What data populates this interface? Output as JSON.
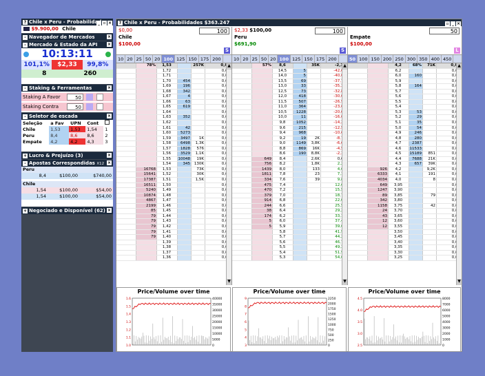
{
  "left": {
    "win_title": "Chile x Peru - Probabilidad",
    "balance": "$9.900,00",
    "balance_sel": "Chile",
    "navigator": "Navegador de Mercados",
    "api_title": "Mercado & Estado da API",
    "clock": "10:13:11",
    "back_pct": "101,1%",
    "mid_val": "$2,33",
    "lay_pct": "99,8%",
    "left_count": "8",
    "right_count": "260",
    "staking_title": "Staking & Ferramentas",
    "stake_fav_label": "Staking A Favor",
    "stake_fav": "50",
    "stake_con_label": "Staking Contra",
    "stake_con": "50",
    "selector_title": "Seletor de escada",
    "sel_headers": [
      "Seleção",
      "a Fav",
      "UPN",
      "Cont"
    ],
    "sel_rows": [
      [
        "Chile",
        "1,53",
        "1,53",
        "1,54",
        "1"
      ],
      [
        "Peru",
        "8,4",
        "8,6",
        "8,6",
        "2"
      ],
      [
        "Empate",
        "4,2",
        "4,2",
        "4,3",
        "3"
      ]
    ],
    "profit_title": "Lucro & Prejuízo (3)",
    "bets_title": "Apostas Correspondidas",
    "bets_tag": "X12",
    "bets_peru": "Peru",
    "bets_peru_row": [
      "8,4",
      "$100,00",
      "$740,00"
    ],
    "bets_chile": "Chile",
    "bets_chile_rows": [
      [
        "1,54",
        "$100,00",
        "$54,00"
      ],
      [
        "1,54",
        "$100,00",
        "$54,00"
      ]
    ],
    "neg_title": "Negociado e Disponível (62)"
  },
  "main": {
    "title": "Chile x Peru - Probabilidades",
    "amount": "$363.247"
  },
  "markets": [
    {
      "name": "Chile",
      "l1a": "$0,00",
      "l1b": "",
      "l3": "$100,00",
      "qty": "100",
      "letter": "S",
      "stakes": [
        "10",
        "20",
        "25",
        "50",
        "20",
        "100",
        "125",
        "150",
        "175",
        "200"
      ],
      "sel": "100",
      "hdr": [
        "",
        "78%",
        "1,53",
        "",
        "257K",
        "0,00"
      ],
      "rows": [
        [
          "",
          "",
          "1,72",
          "",
          "",
          "0,00"
        ],
        [
          "",
          "",
          "1,71",
          "",
          "",
          "0,00"
        ],
        [
          "",
          "",
          "1,70",
          "454",
          "",
          "0,00"
        ],
        [
          "",
          "",
          "1,69",
          "196",
          "",
          "0,00"
        ],
        [
          "",
          "",
          "1,68",
          "342",
          "",
          "0,00"
        ],
        [
          "",
          "",
          "1,67",
          "4",
          "",
          "0,00"
        ],
        [
          "",
          "",
          "1,66",
          "63",
          "",
          "0,00"
        ],
        [
          "",
          "",
          "1,65",
          "619",
          "",
          "0,00"
        ],
        [
          "",
          "",
          "1,64",
          "",
          "",
          "0,00"
        ],
        [
          "",
          "",
          "1,63",
          "352",
          "",
          "0,00"
        ],
        [
          "",
          "",
          "1,62",
          "",
          "",
          "0,00"
        ],
        [
          "",
          "",
          "1,61",
          "42",
          "",
          "0,00"
        ],
        [
          "",
          "",
          "1,60",
          "5273",
          "",
          "0,00"
        ],
        [
          "",
          "",
          "1,59",
          "3497",
          "1K",
          "0,00"
        ],
        [
          "",
          "",
          "1,58",
          "6498",
          "1,3K",
          "0,00"
        ],
        [
          "",
          "",
          "1,57",
          "1828",
          "576",
          "0,00"
        ],
        [
          "",
          "",
          "1,56",
          "3529",
          "1,1K",
          "0,00"
        ],
        [
          "",
          "",
          "1,55",
          "10048",
          "19K",
          "0,00"
        ],
        [
          "",
          "",
          "1,54",
          "345",
          "130K",
          "0,00"
        ],
        [
          "",
          "16768",
          "1,53",
          "",
          "73K",
          "0,00"
        ],
        [
          "",
          "15641",
          "1,52",
          "",
          "30K",
          "0,00"
        ],
        [
          "",
          "17387",
          "1,51",
          "",
          "1,5K",
          "0,00"
        ],
        [
          "",
          "16511",
          "1,50",
          "",
          "",
          "0,00"
        ],
        [
          "",
          "5240",
          "1,49",
          "",
          "",
          "0,00"
        ],
        [
          "",
          "10874",
          "1,48",
          "",
          "",
          "0,00"
        ],
        [
          "",
          "4867",
          "1,47",
          "",
          "",
          "0,00"
        ],
        [
          "",
          "2199",
          "1,46",
          "",
          "",
          "0,00"
        ],
        [
          "",
          "85",
          "1,45",
          "",
          "",
          "0,00"
        ],
        [
          "",
          "79",
          "1,44",
          "",
          "",
          "0,00"
        ],
        [
          "",
          "79",
          "1,43",
          "",
          "",
          "0,00"
        ],
        [
          "",
          "79",
          "1,42",
          "",
          "",
          "0,00"
        ],
        [
          "",
          "79",
          "1,41",
          "",
          "",
          "0,00"
        ],
        [
          "",
          "79",
          "1,40",
          "",
          "",
          "0,00"
        ],
        [
          "",
          "",
          "1,39",
          "",
          "",
          "0,00"
        ],
        [
          "",
          "",
          "1,38",
          "",
          "",
          "0,00"
        ],
        [
          "",
          "",
          "1,37",
          "",
          "",
          "0,00"
        ],
        [
          "",
          "",
          "1,36",
          "",
          "",
          "0,00"
        ]
      ],
      "chart": {
        "title": "Price/Volume over time",
        "yl": [
          "1.6",
          "1.5",
          "1.4",
          "1.3",
          "1.2",
          "1.1",
          "1.0"
        ],
        "yr": [
          "40000",
          "35000",
          "30000",
          "25000",
          "20000",
          "15000",
          "10000",
          "5000",
          "0"
        ]
      }
    },
    {
      "name": "Peru",
      "l1a": "$2,33",
      "l1b": "$100,00",
      "l3": "$691,90",
      "qty": "100",
      "letter": "S",
      "stakes": [
        "10",
        "20",
        "25",
        "50",
        "20",
        "100",
        "125",
        "150",
        "175",
        "200"
      ],
      "sel": "100",
      "hdr": [
        "",
        "57%",
        "8,6",
        "",
        "35K",
        "-2,33"
      ],
      "rows": [
        [
          "",
          "",
          "14,5",
          "5",
          "",
          "-42,07"
        ],
        [
          "",
          "",
          "14,0",
          "5",
          "",
          "-40,00"
        ],
        [
          "",
          "",
          "13,5",
          "69",
          "",
          "-37,78"
        ],
        [
          "",
          "",
          "13,0",
          "33",
          "",
          "-35,38"
        ],
        [
          "",
          "",
          "12,5",
          "73",
          "",
          "-32,80"
        ],
        [
          "",
          "",
          "12,0",
          "418",
          "",
          "-30,00"
        ],
        [
          "",
          "",
          "11,5",
          "507",
          "",
          "-26,96"
        ],
        [
          "",
          "",
          "11,0",
          "364",
          "",
          "-23,64"
        ],
        [
          "",
          "",
          "10,5",
          "1228",
          "",
          "-20,00"
        ],
        [
          "",
          "",
          "10,0",
          "11",
          "",
          "-16,00"
        ],
        [
          "",
          "",
          "9,8",
          "1052",
          "",
          "-14,29"
        ],
        [
          "",
          "",
          "9,6",
          "215",
          "",
          "-12,50"
        ],
        [
          "",
          "",
          "9,4",
          "968",
          "",
          "-10,64"
        ],
        [
          "",
          "",
          "9,2",
          "19",
          "2K",
          "-8,70"
        ],
        [
          "",
          "",
          "9,0",
          "1149",
          "3,8K",
          "-6,67"
        ],
        [
          "",
          "",
          "8,8",
          "869",
          "16K",
          "-4,55"
        ],
        [
          "",
          "",
          "8,6",
          "190",
          "8,8K",
          "-2,33"
        ],
        [
          "",
          "649",
          "8,4",
          "",
          "2,6K",
          "0,00"
        ],
        [
          "",
          "756",
          "8,2",
          "",
          "1,8K",
          "2,28"
        ],
        [
          "",
          "1439",
          "8,0",
          "",
          "133",
          "4,68"
        ],
        [
          "",
          "1811",
          "7,8",
          "",
          "23",
          "7,19"
        ],
        [
          "",
          "334",
          "7,6",
          "",
          "39",
          "9,85"
        ],
        [
          "",
          "475",
          "7,4",
          "",
          "",
          "12,63"
        ],
        [
          "",
          "470",
          "7,2",
          "",
          "",
          "15,59"
        ],
        [
          "",
          "379",
          "7,0",
          "",
          "",
          "18,70"
        ],
        [
          "",
          "914",
          "6,8",
          "",
          "",
          "22,00"
        ],
        [
          "",
          "244",
          "6,6",
          "",
          "",
          "25,50"
        ],
        [
          "",
          "38",
          "6,4",
          "",
          "",
          "29,22"
        ],
        [
          "",
          "174",
          "6,2",
          "",
          "",
          "33,17"
        ],
        [
          "",
          "5",
          "6,0",
          "",
          "",
          "37,40"
        ],
        [
          "",
          "5",
          "5,9",
          "",
          "",
          "39,62"
        ],
        [
          "",
          "",
          "5,8",
          "",
          "",
          "41,92"
        ],
        [
          "",
          "",
          "5,7",
          "",
          "",
          "44,29"
        ],
        [
          "",
          "",
          "5,6",
          "",
          "",
          "46,75"
        ],
        [
          "",
          "",
          "5,5",
          "",
          "",
          "49,30"
        ],
        [
          "",
          "",
          "5,4",
          "",
          "",
          "51,95"
        ],
        [
          "",
          "",
          "5,3",
          "",
          "",
          "54,69"
        ]
      ],
      "chart": {
        "title": "Price/Volume over time",
        "yl": [
          "9",
          "8",
          "7",
          "6",
          "5",
          "4",
          "3"
        ],
        "yr": [
          "2250",
          "2000",
          "1750",
          "1500",
          "1250",
          "1000",
          "750",
          "500",
          "250",
          "0"
        ]
      }
    },
    {
      "name": "Empate",
      "l1a": "",
      "l1b": "",
      "l3": "$100,00",
      "qty": "50",
      "letter": "L",
      "stakes": [
        "50",
        "100",
        "150",
        "200",
        "250",
        "300",
        "350",
        "400",
        "450"
      ],
      "sel": "50",
      "hdr": [
        "",
        "",
        "4,2",
        "68%",
        "71K",
        "0,00"
      ],
      "rows": [
        [
          "",
          "",
          "6,2",
          "",
          "",
          "0,00"
        ],
        [
          "",
          "",
          "6,0",
          "160",
          "",
          "0,00"
        ],
        [
          "",
          "",
          "5,9",
          "",
          "",
          "0,00"
        ],
        [
          "",
          "",
          "5,8",
          "164",
          "",
          "0,00"
        ],
        [
          "",
          "",
          "5,7",
          "",
          "",
          "0,00"
        ],
        [
          "",
          "",
          "5,6",
          "",
          "",
          "0,00"
        ],
        [
          "",
          "",
          "5,5",
          "",
          "",
          "0,00"
        ],
        [
          "",
          "",
          "5,4",
          "",
          "",
          "0,00"
        ],
        [
          "",
          "",
          "5,3",
          "53",
          "",
          "0,00"
        ],
        [
          "",
          "",
          "5,2",
          "29",
          "",
          "0,00"
        ],
        [
          "",
          "",
          "5,1",
          "35",
          "",
          "0,00"
        ],
        [
          "",
          "",
          "5,0",
          "54",
          "",
          "0,00"
        ],
        [
          "",
          "",
          "4,9",
          "246",
          "",
          "0,00"
        ],
        [
          "",
          "",
          "4,8",
          "280",
          "",
          "0,00"
        ],
        [
          "",
          "",
          "4,7",
          "2387",
          "",
          "0,00"
        ],
        [
          "",
          "",
          "4,6",
          "11533",
          "",
          "0,00"
        ],
        [
          "",
          "",
          "4,5",
          "15189",
          "851",
          "0,00"
        ],
        [
          "",
          "",
          "4,4",
          "7688",
          "21K",
          "0,00"
        ],
        [
          "",
          "",
          "4,3",
          "657",
          "39K",
          "0,00"
        ],
        [
          "",
          "926",
          "4,2",
          "",
          "9,2K",
          "0,00"
        ],
        [
          "",
          "6333",
          "4,1",
          "",
          "191",
          "0,00"
        ],
        [
          "",
          "4034",
          "4,0",
          "",
          "8",
          "0,00"
        ],
        [
          "",
          "649",
          "3,95",
          "",
          "",
          "0,00"
        ],
        [
          "",
          "1247",
          "3,90",
          "",
          "",
          "0,00"
        ],
        [
          "",
          "89",
          "3,85",
          "",
          "79",
          "0,00"
        ],
        [
          "",
          "342",
          "3,80",
          "",
          "",
          "0,00"
        ],
        [
          "",
          "1158",
          "3,75",
          "",
          "42",
          "0,00"
        ],
        [
          "",
          "24",
          "3,70",
          "",
          "",
          "0,00"
        ],
        [
          "",
          "43",
          "3,65",
          "",
          "",
          "0,00"
        ],
        [
          "",
          "12",
          "3,60",
          "",
          "",
          "0,00"
        ],
        [
          "",
          "12",
          "3,55",
          "",
          "",
          "0,00"
        ],
        [
          "",
          "",
          "3,50",
          "",
          "",
          "0,00"
        ],
        [
          "",
          "",
          "3,45",
          "",
          "",
          "0,00"
        ],
        [
          "",
          "",
          "3,40",
          "",
          "",
          "0,00"
        ],
        [
          "",
          "",
          "3,35",
          "",
          "",
          "0,00"
        ],
        [
          "",
          "",
          "3,30",
          "",
          "",
          "0,00"
        ],
        [
          "",
          "",
          "3,25",
          "",
          "",
          "0,00"
        ]
      ],
      "chart": {
        "title": "Price/Volume over time",
        "yl": [
          "4.5",
          "4.0",
          "3.5",
          "3.0",
          "2.5"
        ],
        "yr": [
          "8000",
          "7000",
          "6000",
          "5000",
          "4000",
          "3000",
          "2000",
          "1000",
          "0"
        ]
      }
    }
  ]
}
